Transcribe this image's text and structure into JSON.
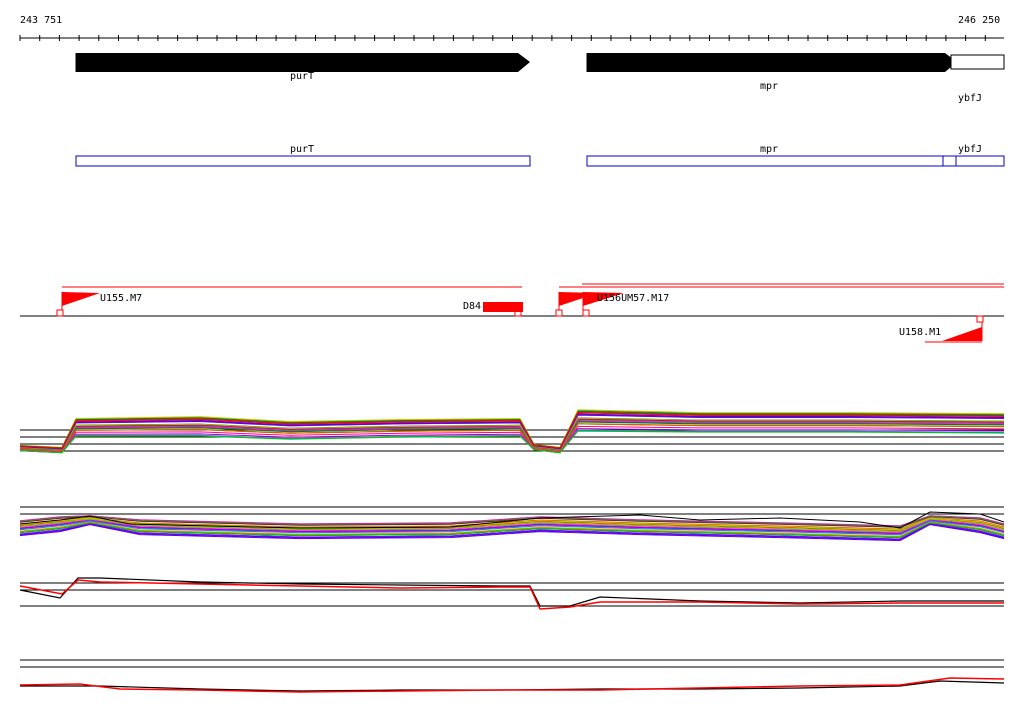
{
  "coords": {
    "start": "243 751",
    "end": "246 250"
  },
  "genes": {
    "purT": "purT",
    "mpr": "mpr",
    "ybfJ": "ybfJ"
  },
  "features": {
    "u155": "U155.M7",
    "d84": "D84",
    "u156": "U156UM57.M17",
    "u158": "U158.M1"
  },
  "colors": {
    "gene_arrow": "#000000",
    "annotation_box": "#0000cc",
    "feature": "#ff0000",
    "profile_line": "#ff0000"
  }
}
